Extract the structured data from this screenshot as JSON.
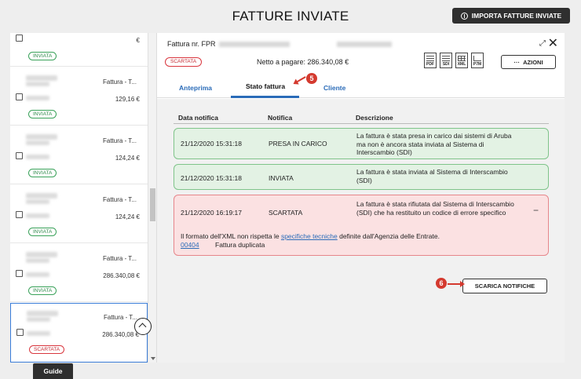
{
  "page": {
    "title": "FATTURE INVIATE",
    "import_label": "IMPORTA FATTURE INVIATE",
    "guide_label": "Guide"
  },
  "list": {
    "top_row": {
      "amount": "€",
      "badge": "INVIATA"
    },
    "rows": [
      {
        "type": "Fattura - T...",
        "amount": "129,16 €",
        "badge": "INVIATA"
      },
      {
        "type": "Fattura - T...",
        "amount": "124,24 €",
        "badge": "INVIATA"
      },
      {
        "type": "Fattura - T...",
        "amount": "124,24 €",
        "badge": "INVIATA"
      },
      {
        "type": "Fattura - T...",
        "amount": "286.340,08 €",
        "badge": "INVIATA"
      },
      {
        "type": "Fattura - T...",
        "amount": "286.340,08 €",
        "badge": "SCARTATA"
      }
    ]
  },
  "detail": {
    "invoice_label": "Fattura nr. FPR",
    "status_badge": "SCARTATA",
    "netto": "Netto a pagare: 286.340,08 €",
    "doc_icons": [
      "PDF",
      "SDI",
      "XML",
      "P7M"
    ],
    "azioni_label": "AZIONI",
    "tabs": {
      "anteprima": "Anteprima",
      "stato": "Stato fattura",
      "cliente": "Cliente"
    },
    "table": {
      "headers": {
        "date": "Data notifica",
        "notifica": "Notifica",
        "desc": "Descrizione"
      },
      "rows": [
        {
          "date": "21/12/2020 15:31:18",
          "notifica": "PRESA IN CARICO",
          "desc": "La fattura è stata presa in carico dai sistemi di Aruba ma non è ancora stata inviata al Sistema di Interscambio (SDI)"
        },
        {
          "date": "21/12/2020 15:31:18",
          "notifica": "INVIATA",
          "desc": "La fattura è stata inviata al Sistema di Interscambio (SDI)"
        },
        {
          "date": "21/12/2020 16:19:17",
          "notifica": "SCARTATA",
          "desc": "La fattura è stata rifiutata dal Sistema di Interscambio (SDI) che ha restituito un codice di errore specifico"
        }
      ],
      "error_detail": {
        "text_before": "Il formato dell'XML non rispetta le",
        "link": "specifiche tecniche",
        "text_after": "definite dall'Agenzia delle Entrate.",
        "code": "00404",
        "code_desc": "Fattura duplicata"
      }
    },
    "scarica_label": "SCARICA NOTIFICHE"
  },
  "markers": {
    "m5": "5",
    "m6": "6"
  },
  "colors": {
    "accent": "#2a6bb8",
    "ok_bg": "#e3f2e4",
    "err_bg": "#fbe1e2",
    "marker": "#d43a2f"
  }
}
